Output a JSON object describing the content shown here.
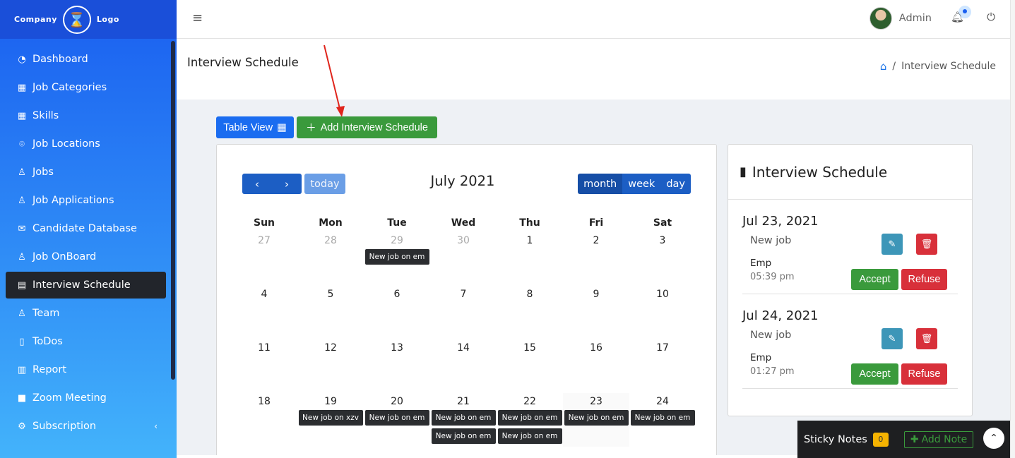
{
  "brand": {
    "left": "Company",
    "right": "Logo"
  },
  "sidebar": {
    "items": [
      {
        "label": "Dashboard",
        "icon": "gauge-icon",
        "glyph": "◔"
      },
      {
        "label": "Job Categories",
        "icon": "grid-icon",
        "glyph": "▦"
      },
      {
        "label": "Skills",
        "icon": "grid-icon",
        "glyph": "▦"
      },
      {
        "label": "Job Locations",
        "icon": "map-pin-icon",
        "glyph": "⌾"
      },
      {
        "label": "Jobs",
        "icon": "user-icon",
        "glyph": "♙"
      },
      {
        "label": "Job Applications",
        "icon": "user-icon",
        "glyph": "♙"
      },
      {
        "label": "Candidate Database",
        "icon": "envelope-icon",
        "glyph": "✉"
      },
      {
        "label": "Job OnBoard",
        "icon": "user-icon",
        "glyph": "♙"
      },
      {
        "label": "Interview Schedule",
        "icon": "calendar-icon",
        "glyph": "▤",
        "active": true
      },
      {
        "label": "Team",
        "icon": "team-icon",
        "glyph": "♙"
      },
      {
        "label": "ToDos",
        "icon": "book-icon",
        "glyph": "▯"
      },
      {
        "label": "Report",
        "icon": "bar-chart-icon",
        "glyph": "▥"
      },
      {
        "label": "Zoom Meeting",
        "icon": "video-icon",
        "glyph": "■"
      },
      {
        "label": "Subscription",
        "icon": "gear-icon",
        "glyph": "⚙",
        "chevron": "‹"
      }
    ]
  },
  "topbar": {
    "user_name": "Admin",
    "menu_icon": "≡",
    "bell_icon": "🔔",
    "power_icon": "⏻"
  },
  "page": {
    "title": "Interview Schedule",
    "breadcrumb_current": "Interview Schedule",
    "breadcrumb_sep": "/"
  },
  "actions": {
    "table_view": "Table View",
    "add_schedule": "Add Interview Schedule"
  },
  "calendar": {
    "title": "July 2021",
    "today_label": "today",
    "views": [
      "month",
      "week",
      "day"
    ],
    "dow": [
      "Sun",
      "Mon",
      "Tue",
      "Wed",
      "Thu",
      "Fri",
      "Sat"
    ],
    "weeks": [
      [
        {
          "d": "27",
          "o": true
        },
        {
          "d": "28",
          "o": true
        },
        {
          "d": "29",
          "o": true,
          "ev": [
            "New job on em"
          ]
        },
        {
          "d": "30",
          "o": true
        },
        {
          "d": "1"
        },
        {
          "d": "2"
        },
        {
          "d": "3"
        }
      ],
      [
        {
          "d": "4"
        },
        {
          "d": "5"
        },
        {
          "d": "6"
        },
        {
          "d": "7"
        },
        {
          "d": "8"
        },
        {
          "d": "9"
        },
        {
          "d": "10"
        }
      ],
      [
        {
          "d": "11"
        },
        {
          "d": "12"
        },
        {
          "d": "13"
        },
        {
          "d": "14"
        },
        {
          "d": "15"
        },
        {
          "d": "16"
        },
        {
          "d": "17"
        }
      ],
      [
        {
          "d": "18"
        },
        {
          "d": "19",
          "ev": [
            "New job on xzv"
          ]
        },
        {
          "d": "20",
          "ev": [
            "New job on em"
          ]
        },
        {
          "d": "21",
          "ev": [
            "New job on em",
            "New job on em"
          ]
        },
        {
          "d": "22",
          "ev": [
            "New job on em",
            "New job on em"
          ]
        },
        {
          "d": "23",
          "ev": [
            "New job on em"
          ],
          "today": true
        },
        {
          "d": "24",
          "ev": [
            "New job on em"
          ]
        }
      ]
    ]
  },
  "schedule_panel": {
    "title": "Interview Schedule",
    "entries": [
      {
        "date": "Jul 23, 2021",
        "title": "New job",
        "who": "Emp",
        "time": "05:39 pm",
        "accept": "Accept",
        "refuse": "Refuse"
      },
      {
        "date": "Jul 24, 2021",
        "title": "New job",
        "who": "Emp",
        "time": "01:27 pm",
        "accept": "Accept",
        "refuse": "Refuse"
      }
    ]
  },
  "sticky_notes": {
    "label": "Sticky Notes",
    "count": "0",
    "add_label": "Add Note"
  }
}
